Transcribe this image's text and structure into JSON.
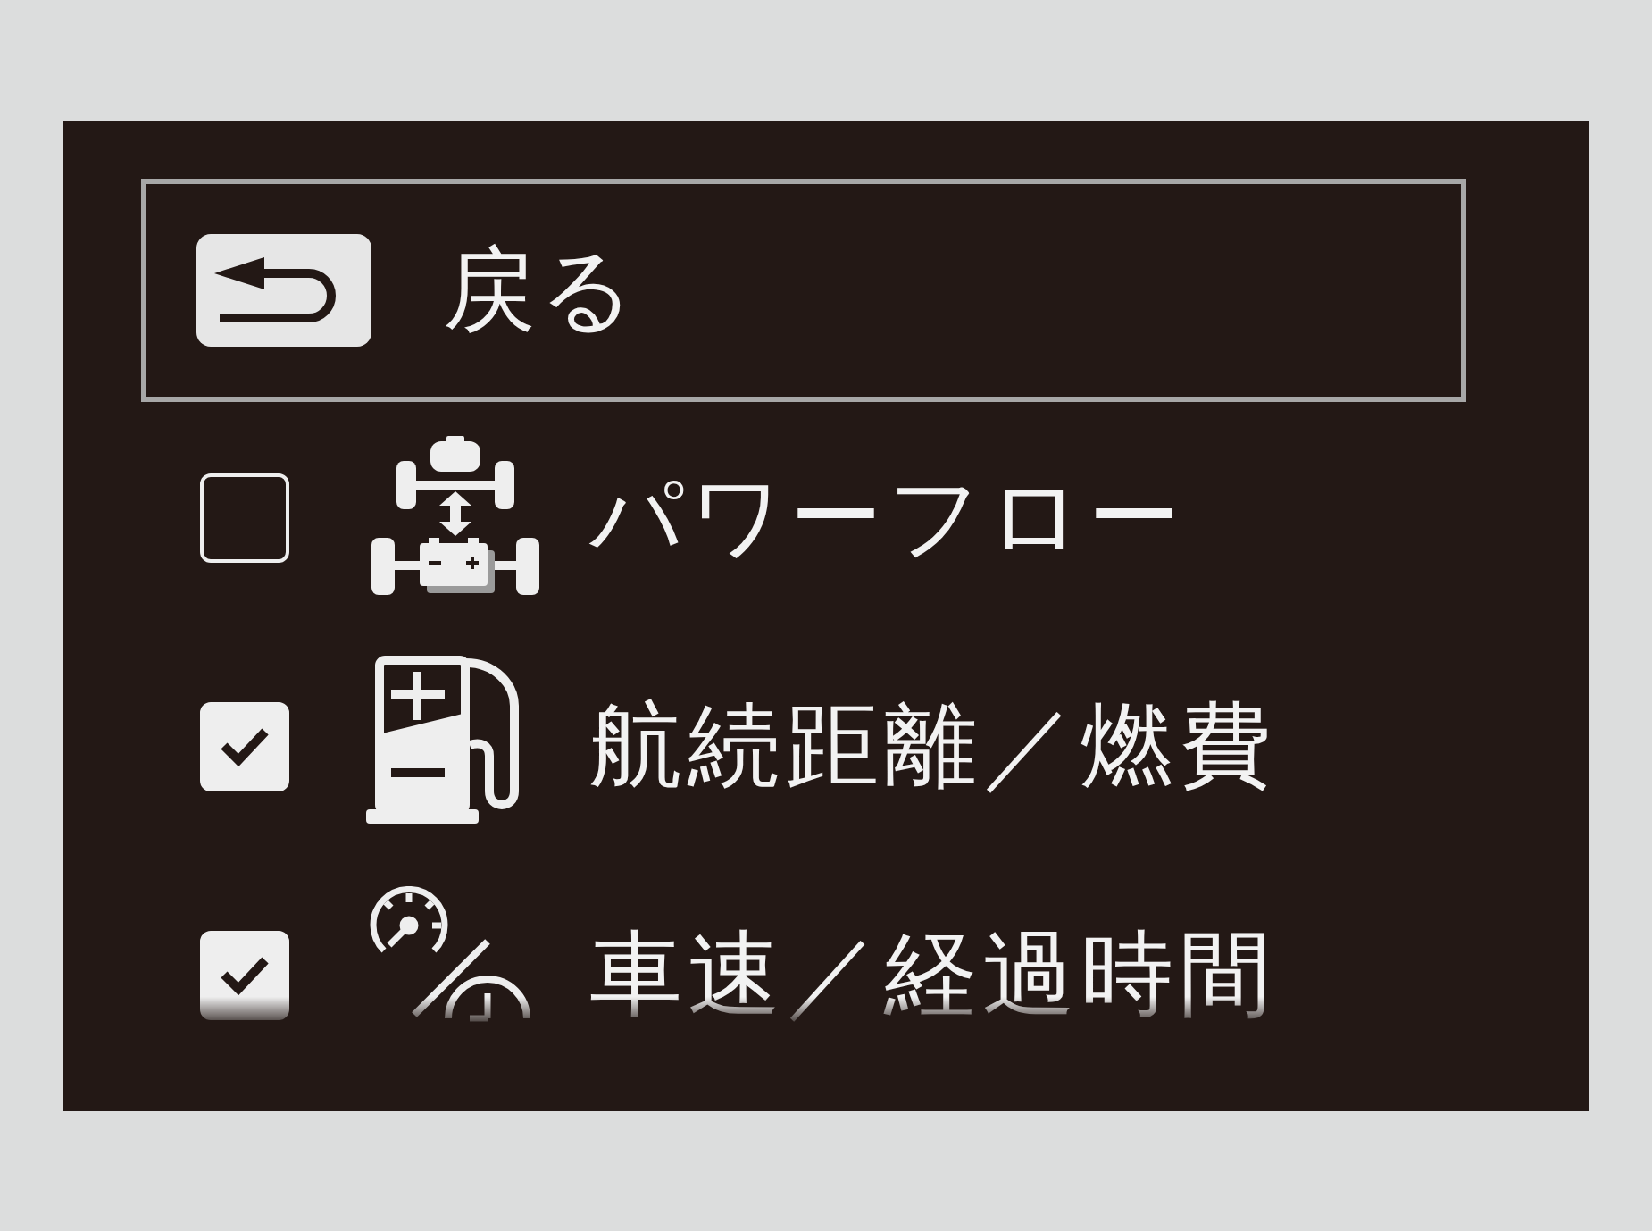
{
  "back_button": {
    "label": "戻る",
    "focused": true
  },
  "items": [
    {
      "kind": "power-flow",
      "label": "パワーフロー",
      "checked": false
    },
    {
      "kind": "fuel",
      "label": "航続距離／燃費",
      "checked": true
    },
    {
      "kind": "speed-time",
      "label": "車速／経過時間",
      "checked": true
    }
  ]
}
